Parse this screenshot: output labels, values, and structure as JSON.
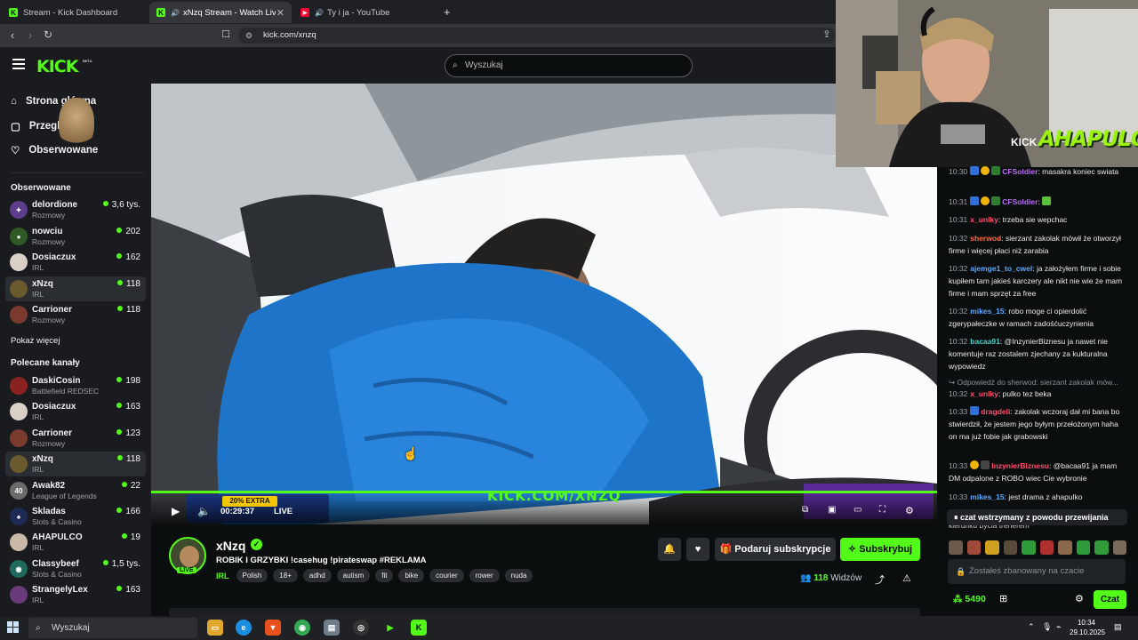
{
  "browser": {
    "tabs": [
      {
        "title": "Stream - Kick Dashboard",
        "active": false
      },
      {
        "title": "xNzq Stream - Watch Live on",
        "active": true
      },
      {
        "title": "Ty i ja - YouTube",
        "active": false
      }
    ],
    "url": "kick.com/xnzq"
  },
  "header": {
    "logo": "KICK",
    "beta": "BETA",
    "search_placeholder": "Wyszukaj"
  },
  "sidebar": {
    "nav": [
      {
        "label": "Strona główna",
        "icon": "home-icon"
      },
      {
        "label": "Przeglądaj",
        "icon": "browse-icon"
      },
      {
        "label": "Obserwowane",
        "icon": "heart-icon"
      }
    ],
    "followed_title": "Obserwowane",
    "followed": [
      {
        "name": "delordione",
        "category": "Rozmowy",
        "viewers": "3,6 tys."
      },
      {
        "name": "nowciu",
        "category": "Rozmowy",
        "viewers": "202"
      },
      {
        "name": "Dosiaczux",
        "category": "IRL",
        "viewers": "162"
      },
      {
        "name": "xNzq",
        "category": "IRL",
        "viewers": "118"
      },
      {
        "name": "Carrioner",
        "category": "Rozmowy",
        "viewers": "118"
      }
    ],
    "show_more": "Pokaż więcej",
    "recommended_title": "Polecane kanały",
    "recommended": [
      {
        "name": "DaskiCosin",
        "category": "Battlefield REDSEC",
        "viewers": "198"
      },
      {
        "name": "Dosiaczux",
        "category": "IRL",
        "viewers": "163"
      },
      {
        "name": "Carrioner",
        "category": "Rozmowy",
        "viewers": "123"
      },
      {
        "name": "xNzq",
        "category": "IRL",
        "viewers": "118"
      },
      {
        "name": "Awak82",
        "category": "League of Legends",
        "viewers": "22"
      },
      {
        "name": "Skladas",
        "category": "Slots & Casino",
        "viewers": "166"
      },
      {
        "name": "AHAPULCO",
        "category": "IRL",
        "viewers": "19"
      },
      {
        "name": "Classybeef",
        "category": "Slots & Casino",
        "viewers": "1,5 tys."
      },
      {
        "name": "StrangelyLex",
        "category": "IRL",
        "viewers": "163"
      }
    ]
  },
  "player": {
    "time": "00:29:37",
    "live_label": "LIVE",
    "overlay_url": "KICK.COM/XNZQ",
    "promo": "20% EXTRA"
  },
  "stream": {
    "channel": "xNzq",
    "live_badge": "LIVE",
    "title": "ROBIK I GRZYBKI !casehug !pirateswap #REKLAMA",
    "category": "IRL",
    "tags": [
      "Polish",
      "18+",
      "adhd",
      "autism",
      "fit",
      "bike",
      "courier",
      "rower",
      "nuda"
    ],
    "gift_label": "Podaruj subskrypcje",
    "subscribe_label": "Subskrybuj",
    "viewers_count": "118",
    "viewers_label": "Widzów"
  },
  "webcam": {
    "overlay_logo": "AHAPULCO",
    "kick_mark": "KICK"
  },
  "chat": {
    "messages": [
      {
        "time": "10:30",
        "user": "CFSoldier",
        "color": "#b96cf0",
        "text": "masakra koniec swiata"
      },
      {
        "time": "10:31",
        "user": "CFSoldier",
        "color": "#b96cf0",
        "text": ""
      },
      {
        "time": "10:31",
        "user": "x_unlky",
        "color": "#ff4d6d",
        "text": "trzeba sie wepchac"
      },
      {
        "time": "10:32",
        "user": "sherwod",
        "color": "#ff6b3d",
        "text": "sierzant zakolak mówił że otworzył firme i więcej płaci niż zarabia"
      },
      {
        "time": "10:32",
        "user": "ajemge1_to_cwel",
        "color": "#5aa9ff",
        "text": "ja założyłem firme i sobie kupiłem tam jakieś karczery ale nikt nie wie że mam firme i mam sprzęt za free"
      },
      {
        "time": "10:32",
        "user": "mikes_15",
        "color": "#5aa9ff",
        "text": "robo moge ci opierdolić zgerypałeczke w ramach zadośćuczynienia"
      },
      {
        "time": "10:32",
        "user": "bacaa91",
        "color": "#43d0c8",
        "text": "@InzynierBiznesu ja nawet nie komentuje raz zostalem zjechany za kukturalna wypowiedz"
      },
      {
        "reply": "Odpowiedź do sherwod: sierzant zakolak mów..."
      },
      {
        "time": "10:32",
        "user": "x_unlky",
        "color": "#ff4d6d",
        "text": "pulko tez beka"
      },
      {
        "time": "10:33",
        "user": "dragdeli",
        "color": "#ff4d6d",
        "text": "zakolak wczoraj dał mi bana bo stwierdził, że jestem jego byłym przełożonym haha on ma już fobie jak grabowski"
      },
      {
        "time": "10:33",
        "user": "InzynierBiznesu",
        "color": "#ff4d6d",
        "text": "@bacaa91 ja mam DM odpalone z ROBO wiec Cie wybronie"
      },
      {
        "time": "10:33",
        "user": "mikes_15",
        "color": "#5aa9ff",
        "text": "jest drama z ahapulko"
      }
    ],
    "paused_label": "czat wstrzymany z powodu przewijania",
    "partial_line": "kierunku bycia trenerem",
    "input_placeholder": "Zostałeś zbanowany na czacie",
    "points": "5490",
    "chat_button": "Czat"
  },
  "taskbar": {
    "search_label": "Wyszukaj",
    "time": "10:34",
    "date": "29.10.2025"
  },
  "colors": {
    "kick_green": "#53fc18",
    "background": "#0b0e0f",
    "sidebar": "#191b1f"
  }
}
